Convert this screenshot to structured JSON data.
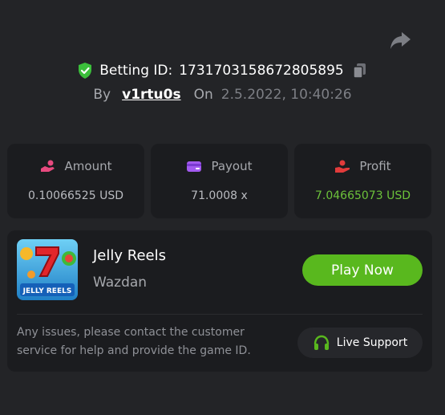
{
  "bet": {
    "id_label": "Betting ID:",
    "id_value": "1731703158672805895",
    "by_label": "By",
    "username": "v1rtu0s",
    "on_label": "On",
    "datetime": "2.5.2022, 10:40:26"
  },
  "stats": {
    "amount": {
      "label": "Amount",
      "value": "0.10066525 USD"
    },
    "payout": {
      "label": "Payout",
      "value": "71.0008 x"
    },
    "profit": {
      "label": "Profit",
      "value": "7.04665073 USD"
    }
  },
  "game": {
    "title": "Jelly Reels",
    "provider": "Wazdan",
    "thumb_text": "JELLY REELS",
    "play_label": "Play Now"
  },
  "support": {
    "notice": "Any issues, please contact the customer service for help and provide the game ID.",
    "button_label": "Live Support"
  },
  "colors": {
    "accent_green": "#59b81e",
    "profit_green": "#6cc23a",
    "shield_green": "#3bbf3b",
    "icon_pink": "#e84a7f",
    "icon_purple": "#a35bf0",
    "icon_red": "#e23b3b"
  }
}
